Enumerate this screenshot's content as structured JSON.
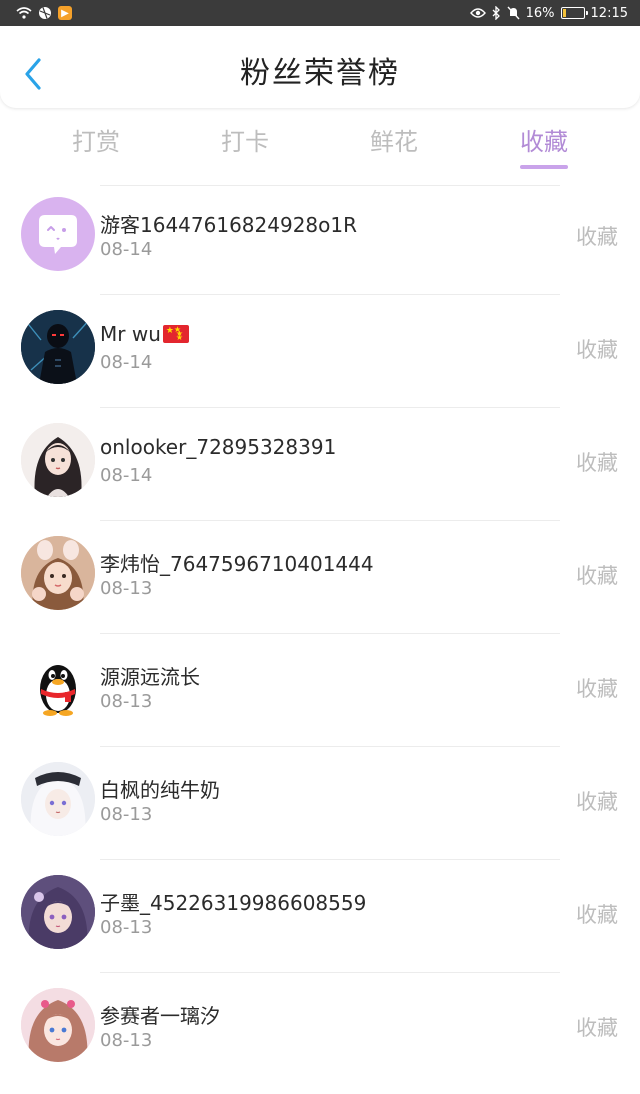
{
  "status_bar": {
    "battery": "16%",
    "time": "12:15",
    "battery_level": 0.16
  },
  "header": {
    "title": "粉丝荣誉榜"
  },
  "tabs": [
    {
      "label": "打赏",
      "active": false
    },
    {
      "label": "打卡",
      "active": false
    },
    {
      "label": "鲜花",
      "active": false
    },
    {
      "label": "收藏",
      "active": true
    }
  ],
  "colors": {
    "accent": "#b28bd6",
    "tab_inactive": "#bdbdbd",
    "status_bar": "#3b3b3b"
  },
  "fans": [
    {
      "name": "游客16447616824928o1R",
      "date": "08-14",
      "action": "收藏",
      "avatar": "chat-bubble-icon"
    },
    {
      "name": "Mr wu",
      "date": "08-14",
      "action": "收藏",
      "avatar": "dark-hero-avatar",
      "flag": "china-flag-icon"
    },
    {
      "name": "onlooker_72895328391",
      "date": "08-14",
      "action": "收藏",
      "avatar": "anime-girl-avatar"
    },
    {
      "name": "李炜怡_7647596710401444",
      "date": "08-13",
      "action": "收藏",
      "avatar": "bunny-ears-girl-avatar"
    },
    {
      "name": "源源远流长",
      "date": "08-13",
      "action": "收藏",
      "avatar": "qq-penguin-avatar"
    },
    {
      "name": "白枫的纯牛奶",
      "date": "08-13",
      "action": "收藏",
      "avatar": "white-hair-anime-avatar"
    },
    {
      "name": "子墨_45226319986608559",
      "date": "08-13",
      "action": "收藏",
      "avatar": "purple-anime-girl-avatar"
    },
    {
      "name": "参赛者一璃汐",
      "date": "08-13",
      "action": "收藏",
      "avatar": "pink-anime-girl-avatar"
    }
  ]
}
